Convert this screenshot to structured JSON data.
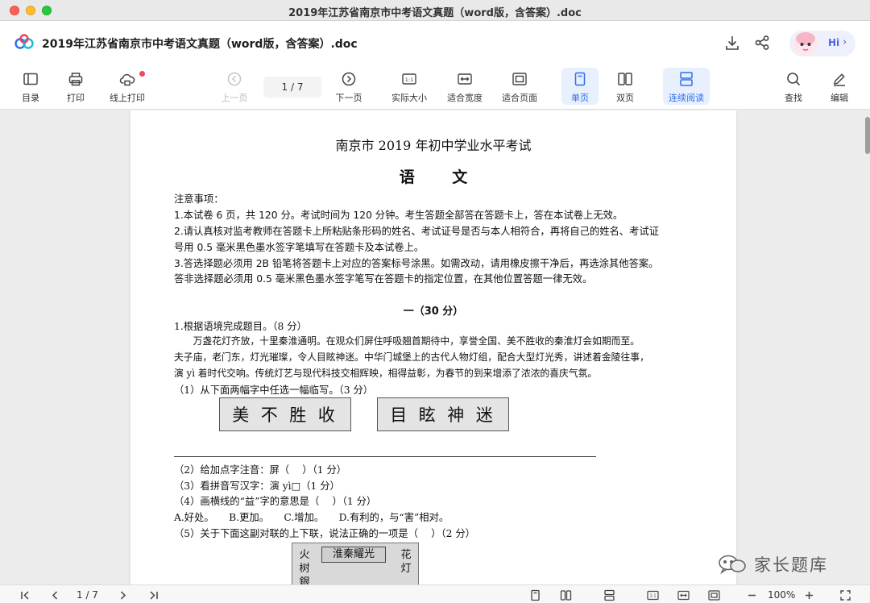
{
  "window": {
    "title": "2019年江苏省南京市中考语文真题（word版，含答案）.doc"
  },
  "header": {
    "doc_name": "2019年江苏省南京市中考语文真题（word版，含答案）.doc",
    "assistant_label": "Hi"
  },
  "toolbar": {
    "toc": "目录",
    "print": "打印",
    "online_print": "线上打印",
    "prev_page": "上一页",
    "page_indicator": "1 / 7",
    "next_page": "下一页",
    "actual_size": "实际大小",
    "fit_width": "适合宽度",
    "fit_page": "适合页面",
    "single_page": "单页",
    "double_page": "双页",
    "continuous": "连续阅读",
    "find": "查找",
    "edit": "编辑"
  },
  "document": {
    "title": "南京市 2019 年初中学业水平考试",
    "subject": "语 文",
    "notice_heading": "注意事项：",
    "notice": [
      "1.本试卷 6 页，共 120 分。考试时间为 120 分钟。考生答题全部答在答题卡上，答在本试卷上无效。",
      "2.请认真核对监考教师在答题卡上所粘贴条形码的姓名、考试证号是否与本人相符合，再将自己的姓名、考试证",
      "号用 0.5 毫米黑色墨水签字笔填写在答题卡及本试卷上。",
      "3.答选择题必须用 2B 铅笔将答题卡上对应的答案标号涂黑。如需改动，请用橡皮擦干净后，再选涂其他答案。",
      "答非选择题必须用 0.5 毫米黑色墨水签字笔写在答题卡的指定位置，在其他位置答题一律无效。"
    ],
    "section_heading": "一（30 分）",
    "q1": "1.根据语境完成题目。（8 分）",
    "passage": [
      "　　万盏花灯齐放，十里秦淮通明。在观众们屏住呼吸翘首期待中，享誉全国、美不胜收的秦淮灯会如期而至。",
      "夫子庙，老门东，灯光璀璨，令人目眩神迷。中华门城堡上的古代人物灯组，配合大型灯光秀，讲述着金陵往事，",
      "演 yì 着时代交响。传统灯艺与现代科技交相辉映，相得益彰，为春节的到来增添了浓浓的喜庆气氛。"
    ],
    "q1_1": "（1）从下面两幅字中任选一幅临写。（3 分）",
    "calligraphy_left": [
      "美",
      "不",
      "胜",
      "收"
    ],
    "calligraphy_right": [
      "目",
      "眩",
      "神",
      "迷"
    ],
    "q1_2": "（2）给加点字注音：屏（　 ）（1 分）",
    "q1_3": "（3）看拼音写汉字：演 yì□（1 分）",
    "q1_4": "（4）画横线的“益”字的意思是（　 ）（1 分）",
    "q1_4_options": "A.好处。　　B.更加。　　C.增加。　　D.有利的，与“害”相对。",
    "q1_5": "（5）关于下面这副对联的上下联，说法正确的一项是（　 ）（2 分）",
    "couplet_banner": "淮秦耀光",
    "couplet_left": "火树銀",
    "couplet_right": "花灯"
  },
  "watermark": {
    "text": "家长题库"
  },
  "bottombar": {
    "page_indicator": "1 / 7",
    "zoom": "100%"
  },
  "colors": {
    "accent": "#2f6fed",
    "active_bg": "#e8effd"
  }
}
